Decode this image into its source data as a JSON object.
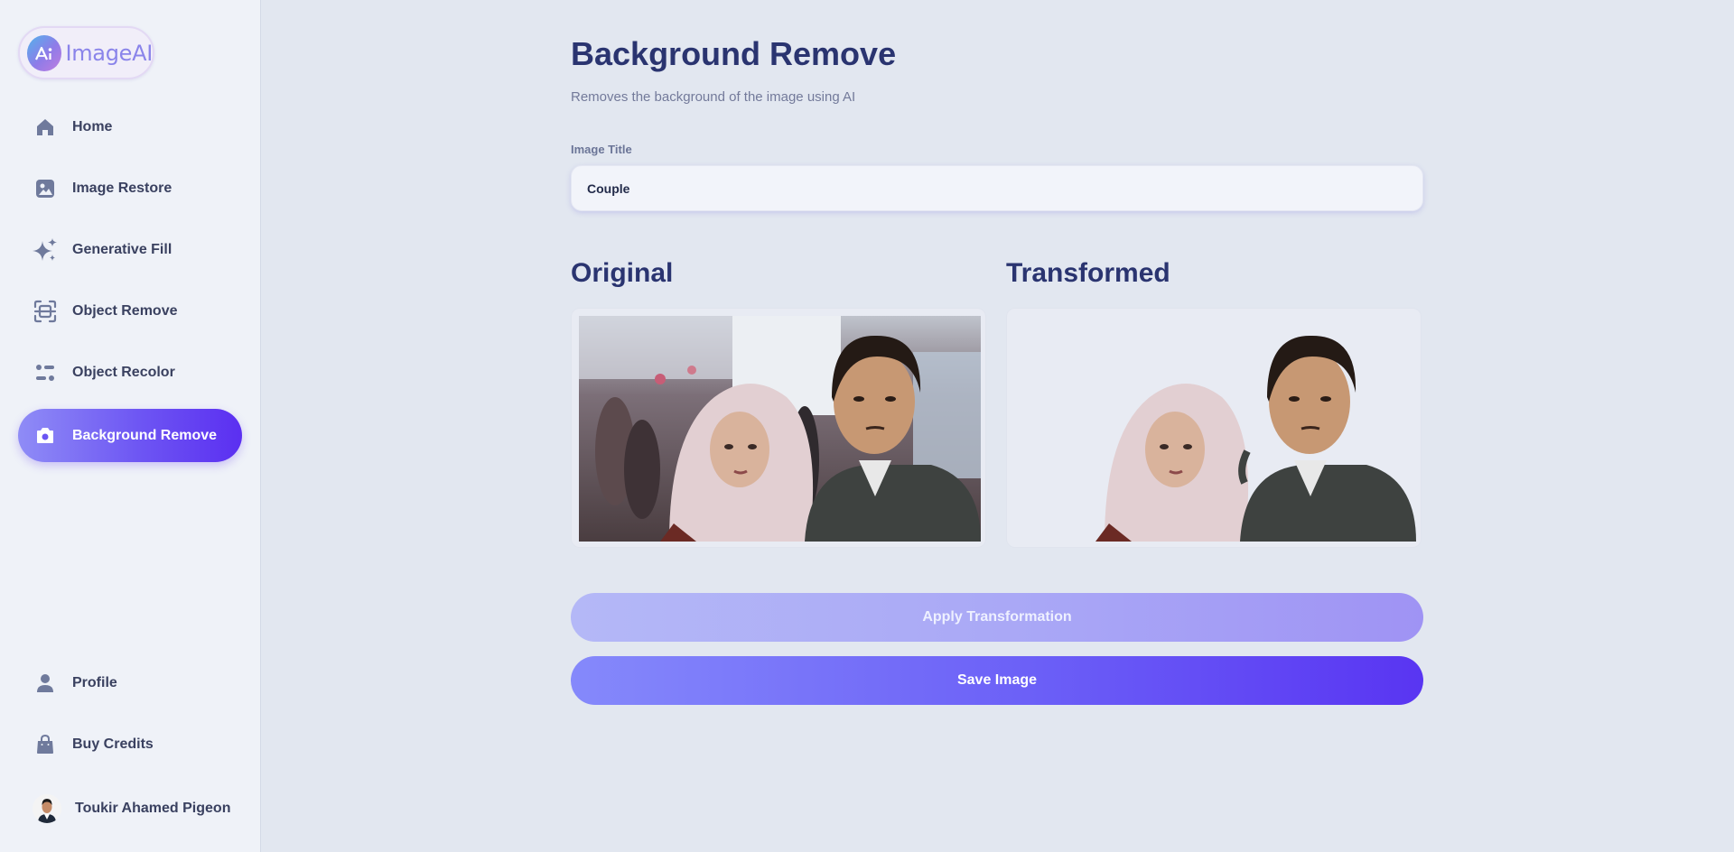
{
  "brand": {
    "name": "ImageAI"
  },
  "sidebar": {
    "items": [
      {
        "label": "Home",
        "icon": "home-icon"
      },
      {
        "label": "Image Restore",
        "icon": "image-icon"
      },
      {
        "label": "Generative Fill",
        "icon": "sparkles-icon"
      },
      {
        "label": "Object Remove",
        "icon": "scan-icon"
      },
      {
        "label": "Object Recolor",
        "icon": "filter-icon"
      },
      {
        "label": "Background Remove",
        "icon": "camera-icon",
        "active": true
      }
    ],
    "bottom_items": [
      {
        "label": "Profile",
        "icon": "user-icon"
      },
      {
        "label": "Buy Credits",
        "icon": "bag-icon"
      }
    ],
    "user": {
      "name": "Toukir Ahamed Pigeon"
    }
  },
  "main": {
    "title": "Background Remove",
    "subtitle": "Removes the background of the image using AI",
    "form": {
      "title_label": "Image Title",
      "title_value": "Couple"
    },
    "original_heading": "Original",
    "transformed_heading": "Transformed",
    "apply_button": "Apply Transformation",
    "save_button": "Save Image"
  },
  "colors": {
    "accent": "#5b2ff1",
    "accent_light": "#8f8cf6",
    "heading": "#2a3470",
    "background": "#e2e7f0",
    "sidebar": "#eff2f8"
  }
}
